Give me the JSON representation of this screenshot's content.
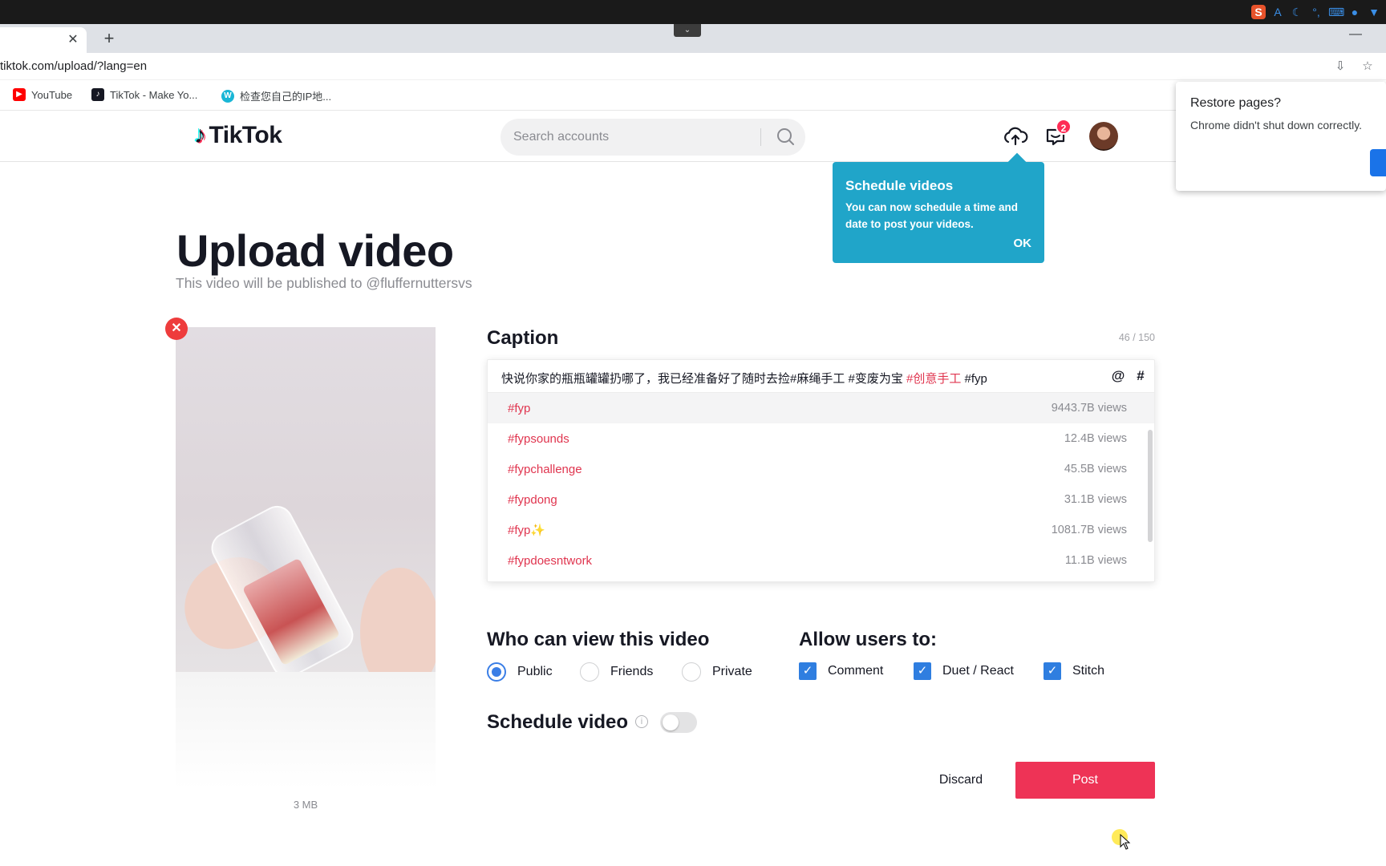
{
  "os": {
    "tray_icons": [
      "ime-s-icon",
      "font-a-icon",
      "moon-icon",
      "punctuation-icon",
      "keyboard-icon",
      "user-icon",
      "shirt-icon"
    ]
  },
  "browser": {
    "url": "tiktok.com/upload/?lang=en",
    "bookmarks": [
      {
        "label": "YouTube",
        "icon": "youtube-icon",
        "color": "#ff0000"
      },
      {
        "label": "TikTok - Make Yo...",
        "icon": "tiktok-icon",
        "color": "#161823"
      },
      {
        "label": "检查您自己的IP地...",
        "icon": "ip-check-icon",
        "color": "#19b6d6"
      }
    ]
  },
  "header": {
    "logo_text": "TikTok",
    "search_placeholder": "Search accounts",
    "inbox_badge": "2"
  },
  "tooltip": {
    "title": "Schedule videos",
    "body": "You can now schedule a time and date to post your videos.",
    "ok_label": "OK"
  },
  "restore_popup": {
    "title": "Restore pages?",
    "body": "Chrome didn't shut down correctly."
  },
  "page": {
    "title": "Upload video",
    "subtitle": "This video will be published to @fluffernuttersvs",
    "file_size": "3 MB"
  },
  "caption": {
    "label": "Caption",
    "count": "46 / 150",
    "text_plain": "快说你家的瓶瓶罐罐扔哪了，我已经准备好了随时去捡#麻绳手工 #变废为宝 ",
    "text_tag": "#创意手工",
    "text_tail": " #fyp",
    "mention_label": "@",
    "hashtag_label": "#",
    "suggestions": [
      {
        "tag": "#fyp",
        "views": "9443.7B views"
      },
      {
        "tag": "#fypsounds",
        "views": "12.4B views"
      },
      {
        "tag": "#fypchallenge",
        "views": "45.5B views"
      },
      {
        "tag": "#fypdong",
        "views": "31.1B views"
      },
      {
        "tag": "#fyp✨",
        "views": "1081.7B views"
      },
      {
        "tag": "#fypdoesntwork",
        "views": "11.1B views"
      }
    ]
  },
  "privacy": {
    "label": "Who can view this video",
    "options": [
      "Public",
      "Friends",
      "Private"
    ],
    "selected": "Public"
  },
  "allow": {
    "label": "Allow users to:",
    "options": [
      "Comment",
      "Duet / React",
      "Stitch"
    ]
  },
  "schedule": {
    "label": "Schedule video",
    "enabled": false
  },
  "actions": {
    "discard_label": "Discard",
    "post_label": "Post"
  },
  "colors": {
    "accent": "#fe2c55",
    "tooltip": "#20a5c9",
    "checkbox": "#2f7ee0"
  }
}
